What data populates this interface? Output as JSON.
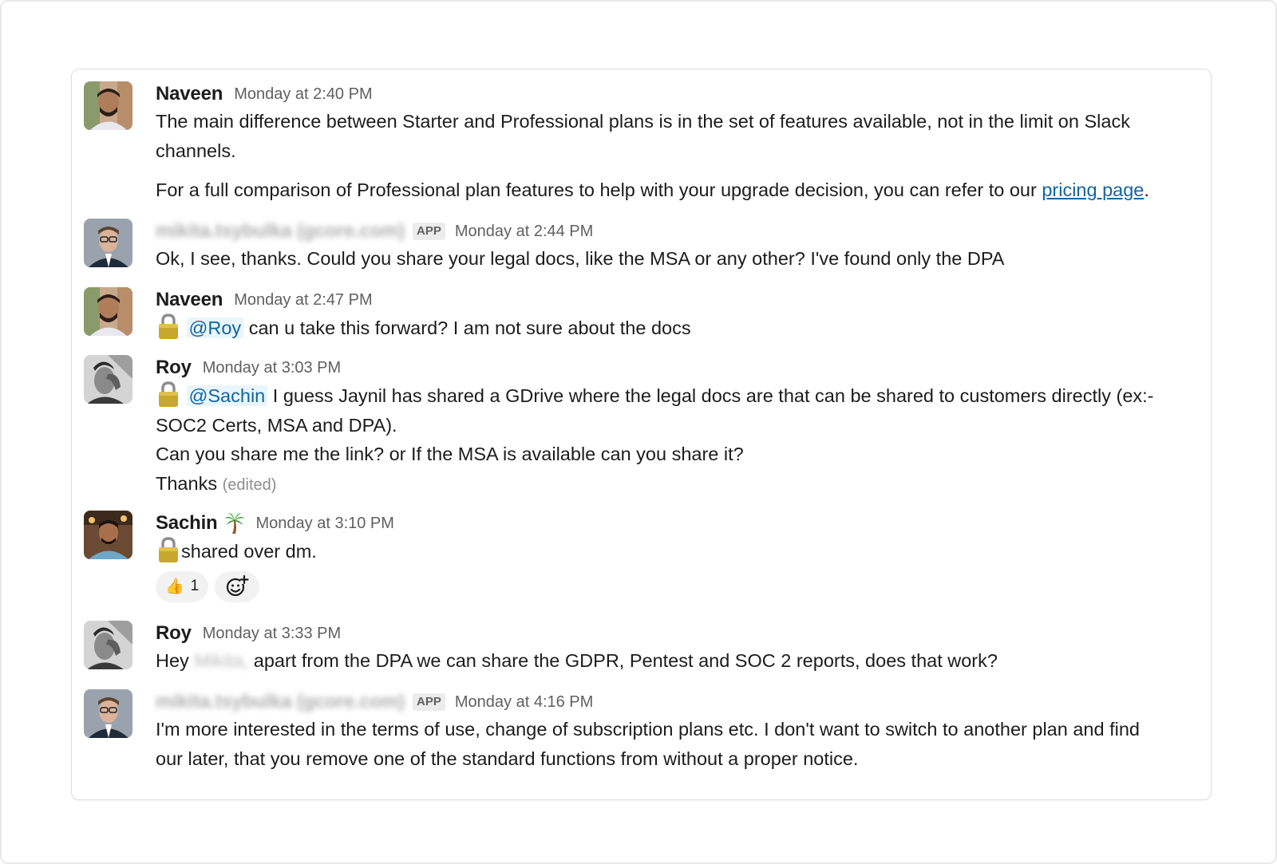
{
  "messages": [
    {
      "author": "Naveen",
      "time": "Monday at 2:40 PM",
      "lines": [
        "The main difference between Starter and Professional plans is in the set of features available, not in the limit on Slack",
        "channels."
      ],
      "p2_text": "For a full comparison of Professional plan features to help with your upgrade decision, you can refer to our ",
      "p2_link": "pricing page",
      "p2_end": "."
    },
    {
      "author": "mikita.tsybulka (gcore.com)",
      "badge": "APP",
      "time": "Monday at 2:44 PM",
      "text": "Ok, I see, thanks. Could you share your legal docs, like the MSA or any other? I've found only the DPA"
    },
    {
      "author": "Naveen",
      "time": "Monday at 2:47 PM",
      "mention": "@Roy",
      "text": "can u take this forward? I am not sure about the docs"
    },
    {
      "author": "Roy",
      "time": "Monday at 3:03 PM",
      "mention": "@Sachin",
      "line1": "I guess Jaynil has shared a GDrive where the legal docs are that can be shared to customers directly (ex:-",
      "line2": "SOC2 Certs, MSA and DPA).",
      "line3": "Can you share me the link? or If the MSA is available can you share it?",
      "line4": "Thanks",
      "edited": "(edited)"
    },
    {
      "author": "Sachin",
      "status_icon": "palm-tree-icon",
      "time": "Monday at 3:10 PM",
      "text": "shared over dm.",
      "reaction_emoji": "👍",
      "reaction_count": "1"
    },
    {
      "author": "Roy",
      "time": "Monday at 3:33 PM",
      "pre": "Hey",
      "blurred": "Mikita,",
      "post": "apart from the DPA we can share the GDPR, Pentest and SOC 2 reports, does that work?"
    },
    {
      "author": "mikita.tsybulka (gcore.com)",
      "badge": "APP",
      "time": "Monday at 4:16 PM",
      "lines": [
        "I'm more interested in the terms of use, change of subscription plans etc. I don't want to switch to another plan and find",
        "our later, that you remove one of the standard functions from without a proper notice."
      ]
    }
  ],
  "colors": {
    "link": "#1264a3",
    "mention_bg": "#e8f5fa",
    "text": "#1d1c1d",
    "muted": "#616061"
  }
}
